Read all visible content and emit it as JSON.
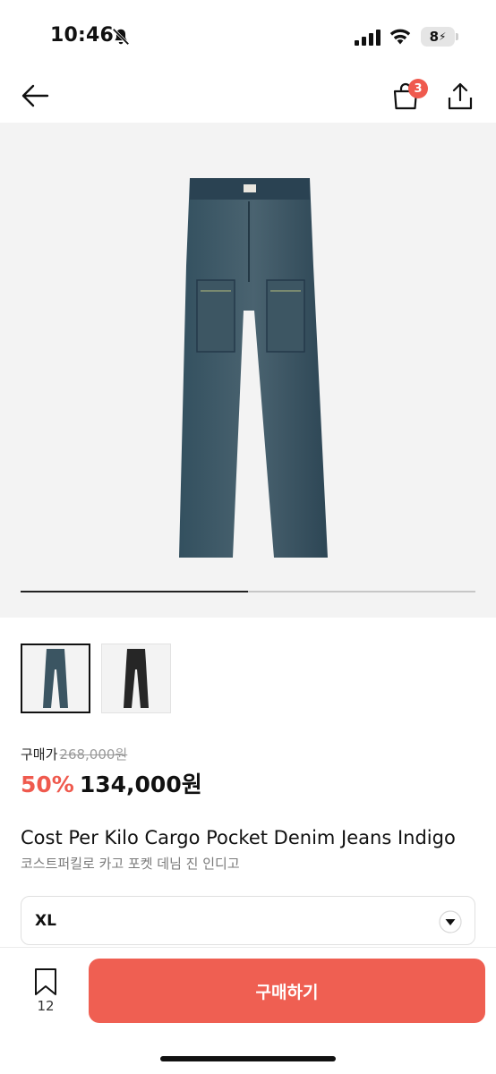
{
  "status_bar": {
    "time": "10:46",
    "battery": "8",
    "icons": [
      "bell-slash-icon",
      "signal-icon",
      "wifi-icon",
      "battery-charging-icon"
    ]
  },
  "nav": {
    "cart_badge": "3",
    "icons": [
      "back-arrow-icon",
      "shopping-bag-icon",
      "share-icon"
    ]
  },
  "gallery": {
    "image_count": 2,
    "current_index": 1,
    "progress_fraction": 0.5,
    "thumbnails": [
      "indigo-jeans",
      "black-jeans"
    ]
  },
  "price": {
    "label": "구매가",
    "original": "268,000원",
    "discount": "50%",
    "sale": "134,000원"
  },
  "product": {
    "title": "Cost Per Kilo Cargo Pocket Denim Jeans Indigo",
    "subtitle": "코스트퍼킬로 카고 포켓 데님 진 인디고"
  },
  "size_select": {
    "value": "XL"
  },
  "bottom_bar": {
    "bookmark_count": "12",
    "buy_label": "구매하기"
  },
  "colors": {
    "accent": "#ef5a4e",
    "button": "#ef5f52",
    "denim": "#2f4452"
  }
}
